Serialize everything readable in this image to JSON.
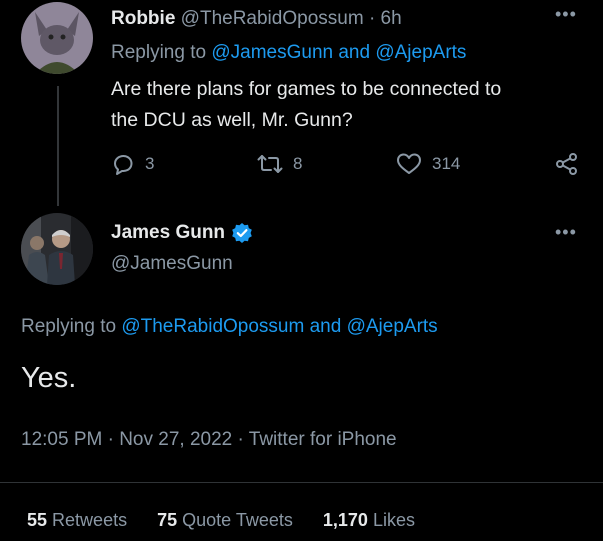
{
  "reply_tweet": {
    "display_name": "Robbie",
    "handle": "@TheRabidOpossum",
    "separator": "·",
    "time_ago": "6h",
    "replying_prefix": "Replying to",
    "replying_mentions": "@JamesGunn and @AjepArts",
    "text_line1": "Are there plans for games to be connected to",
    "text_line2": "the DCU as well, Mr. Gunn?",
    "replies": "3",
    "retweets": "8",
    "likes": "314"
  },
  "main_tweet": {
    "display_name": "James Gunn",
    "handle": "@JamesGunn",
    "replying_prefix": "Replying to",
    "replying_mentions": "@TheRabidOpossum and @AjepArts",
    "text": "Yes.",
    "timestamp": "12:05 PM · Nov 27, 2022 · Twitter for iPhone",
    "stats": {
      "retweets_count": "55",
      "retweets_label": "Retweets",
      "quotes_count": "75",
      "quotes_label": "Quote Tweets",
      "likes_count": "1,170",
      "likes_label": "Likes"
    }
  },
  "colors": {
    "background": "#000000",
    "text": "#e7e9ea",
    "muted": "#8b98a5",
    "link": "#1d9bf0",
    "verified": "#1d9bf0"
  },
  "icons": {
    "reply": "reply-icon",
    "retweet": "retweet-icon",
    "like": "heart-icon",
    "share": "share-icon",
    "more": "more-icon",
    "verified": "verified-badge-icon"
  }
}
